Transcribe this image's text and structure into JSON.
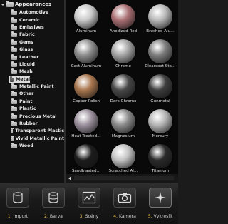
{
  "tree": {
    "root_label": "Appearances",
    "items": [
      {
        "label": "Automotive",
        "selected": false
      },
      {
        "label": "Ceramic",
        "selected": false
      },
      {
        "label": "Emissives",
        "selected": false
      },
      {
        "label": "Fabric",
        "selected": false
      },
      {
        "label": "Gems",
        "selected": false
      },
      {
        "label": "Glass",
        "selected": false
      },
      {
        "label": "Leather",
        "selected": false
      },
      {
        "label": "Liquid",
        "selected": false
      },
      {
        "label": "Mesh",
        "selected": false
      },
      {
        "label": "Metal",
        "selected": true
      },
      {
        "label": "Metallic Paint",
        "selected": false
      },
      {
        "label": "Other",
        "selected": false
      },
      {
        "label": "Paint",
        "selected": false
      },
      {
        "label": "Plastic",
        "selected": false
      },
      {
        "label": "Precious Metal",
        "selected": false
      },
      {
        "label": "Rubber",
        "selected": false
      },
      {
        "label": "Transparent Plastic",
        "selected": false
      },
      {
        "label": "Vivid Metallic Paint",
        "selected": false
      },
      {
        "label": "Wood",
        "selected": false
      }
    ]
  },
  "materials": [
    {
      "label": "Aluminum",
      "color": "#c9c9c9"
    },
    {
      "label": "Anodized Red",
      "color": "#a86e72"
    },
    {
      "label": "Brushed Alu…",
      "color": "#b8b8b8"
    },
    {
      "label": "Cast Aluminum",
      "color": "#8e8e8e"
    },
    {
      "label": "Chrome",
      "color": "#a4a4a4"
    },
    {
      "label": "Clearcoat Sta…",
      "color": "#7c7c7c"
    },
    {
      "label": "Copper Polish",
      "color": "#a8764e"
    },
    {
      "label": "Dark Chrome",
      "color": "#474747"
    },
    {
      "label": "Gunmetal",
      "color": "#3d3d3d"
    },
    {
      "label": "Heat Treated…",
      "color": "#9a8f9c"
    },
    {
      "label": "Magnesium",
      "color": "#8a8a8a"
    },
    {
      "label": "Mercury",
      "color": "#b4b4b4"
    },
    {
      "label": "Sandblasted…",
      "color": "#1c1c1c"
    },
    {
      "label": "Scratched Al…",
      "color": "#c2c2c2"
    },
    {
      "label": "Titanium",
      "color": "#2a2a2a"
    }
  ],
  "toolbar": {
    "tools": [
      {
        "num": "1.",
        "label": "Import",
        "icon": "import-cylinder-icon"
      },
      {
        "num": "2.",
        "label": "Barva",
        "icon": "materials-cylinder-icon"
      },
      {
        "num": "3.",
        "label": "Scény",
        "icon": "scenes-chart-icon"
      },
      {
        "num": "4.",
        "label": "Kamera",
        "icon": "camera-icon"
      },
      {
        "num": "5.",
        "label": "Vykreslit",
        "icon": "render-sparkle-icon"
      }
    ]
  }
}
